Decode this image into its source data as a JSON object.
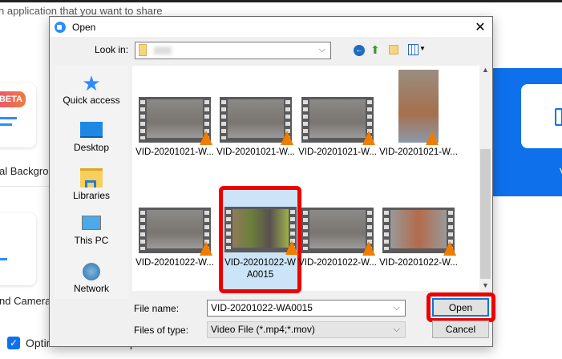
{
  "background": {
    "instruction": "n application that you want to share",
    "beta_badge": "BETA",
    "virtual_bg_label": "al Background",
    "camera_label": "nd Camera",
    "optimize_label": "Optimize for video clip",
    "optimize_checked": true,
    "right_label": "V"
  },
  "dialog": {
    "title": "Open",
    "look_in_label": "Look in:",
    "sidebar": [
      {
        "label": "Quick access",
        "icon": "star-icon"
      },
      {
        "label": "Desktop",
        "icon": "desktop-icon"
      },
      {
        "label": "Libraries",
        "icon": "libraries-icon"
      },
      {
        "label": "This PC",
        "icon": "computer-icon"
      },
      {
        "label": "Network",
        "icon": "network-icon"
      }
    ],
    "files": [
      {
        "label": "VID-20201021-W..."
      },
      {
        "label": "VID-20201021-W..."
      },
      {
        "label": "VID-20201021-W..."
      },
      {
        "label": "VID-20201021-W..."
      },
      {
        "label": "VID-20201022-W..."
      },
      {
        "label": "VID-20201022-WA0015"
      },
      {
        "label": "VID-20201022-W..."
      },
      {
        "label": "VID-20201022-W..."
      }
    ],
    "file_name_label": "File name:",
    "file_name_value": "VID-20201022-WA0015",
    "file_type_label": "Files of type:",
    "file_type_value": "Video File (*.mp4;*.mov)",
    "open_label": "Open",
    "cancel_label": "Cancel",
    "highlight_color": "#ee0000"
  }
}
